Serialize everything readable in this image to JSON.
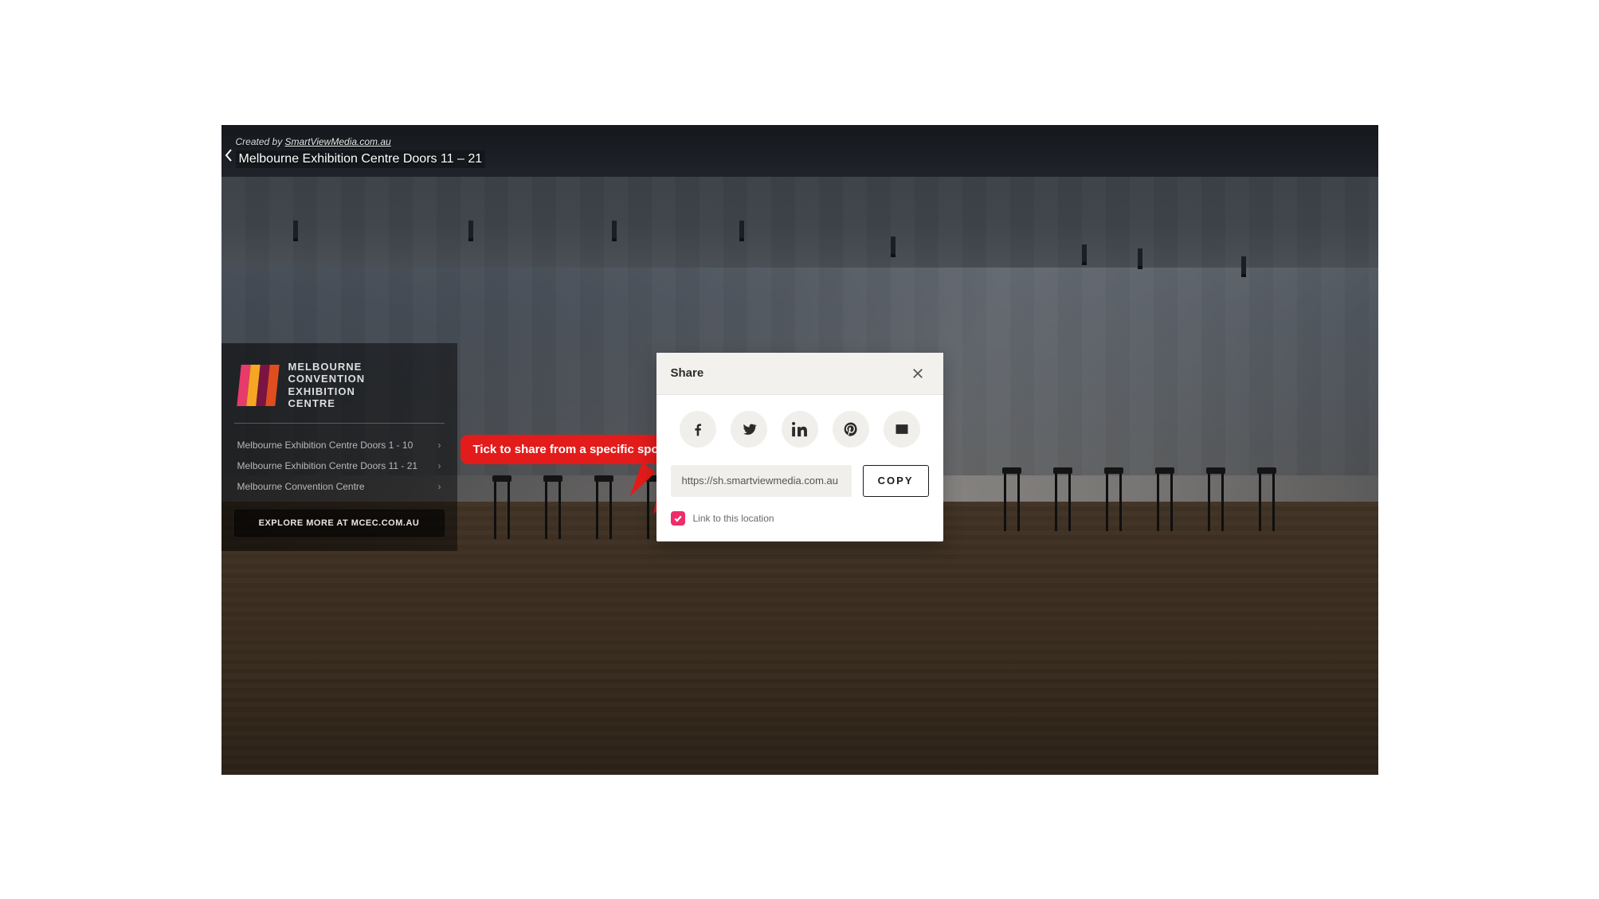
{
  "topbar": {
    "credit_prefix": "Created by ",
    "credit_link": "SmartViewMedia.com.au",
    "location_title": "Melbourne Exhibition Centre Doors 11 – 21"
  },
  "side_panel": {
    "logo_lines": [
      "MELBOURNE",
      "CONVENTION",
      "EXHIBITION",
      "CENTRE"
    ],
    "items": [
      "Melbourne Exhibition Centre Doors 1 - 10",
      "Melbourne Exhibition Centre Doors 11 - 21",
      "Melbourne Convention Centre"
    ],
    "cta": "EXPLORE MORE AT MCEC.COM.AU"
  },
  "share": {
    "title": "Share",
    "social": {
      "facebook": "facebook-icon",
      "twitter": "twitter-icon",
      "linkedin": "linkedin-icon",
      "pinterest": "pinterest-icon",
      "email": "email-icon"
    },
    "url_value": "https://sh.smartviewmedia.com.au",
    "copy_label": "COPY",
    "link_location_checked": true,
    "link_location_label": "Link to this location"
  },
  "callout": {
    "text": "Tick to share from a specific spot"
  },
  "colors": {
    "accent_pink": "#ee2d6a",
    "callout_red": "#e41b1b"
  }
}
